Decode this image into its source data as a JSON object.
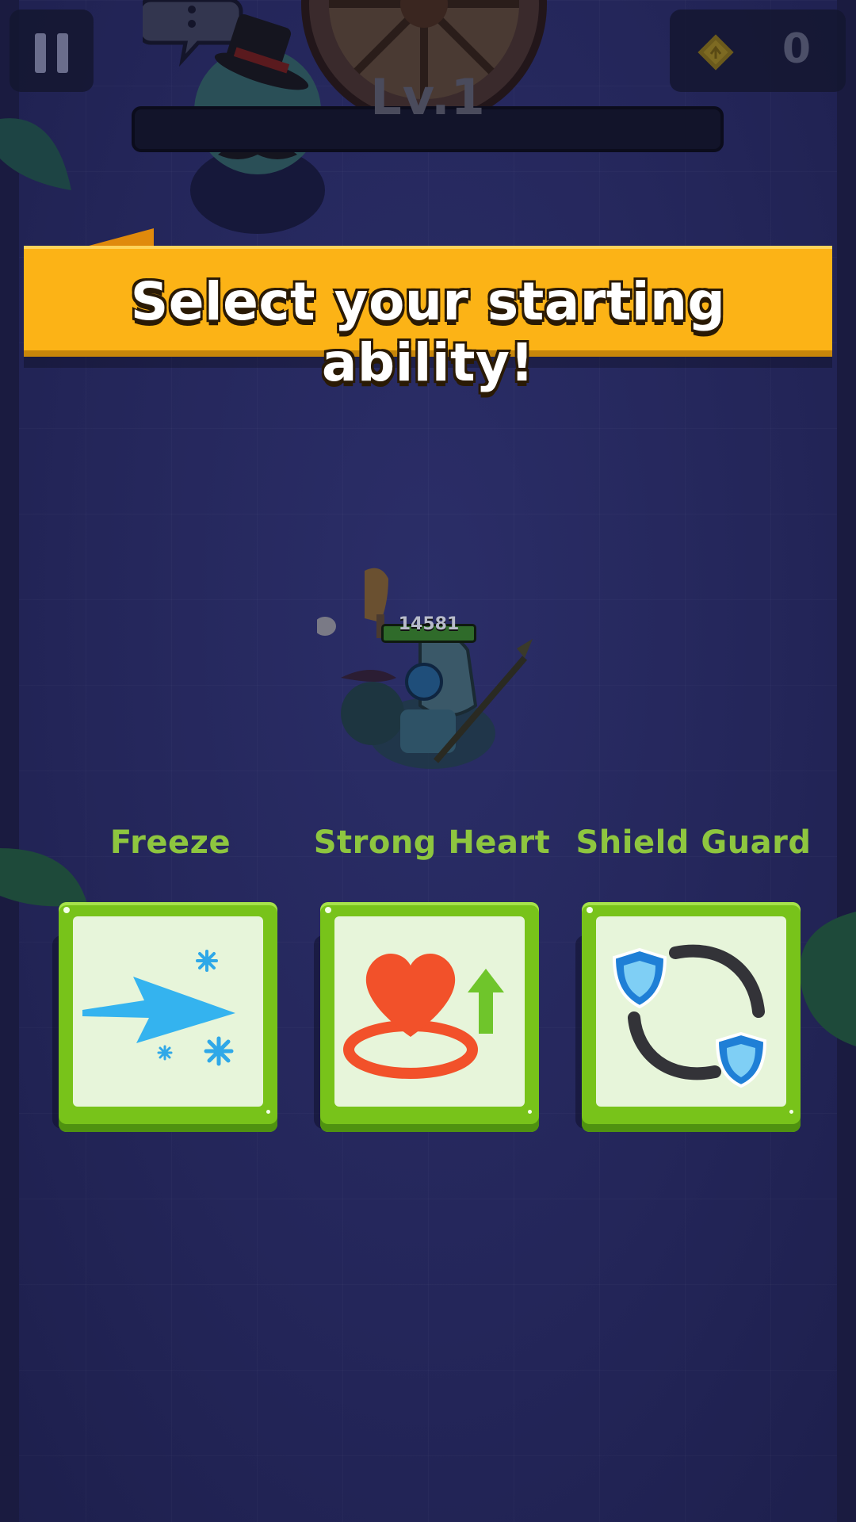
{
  "hud": {
    "gold_count": "0",
    "level": "Lv.1"
  },
  "banner": {
    "title": "Select your starting ability!"
  },
  "player": {
    "hp": "14581"
  },
  "abilities": [
    {
      "label": "Freeze",
      "icon": "freeze-arrow-icon"
    },
    {
      "label": "Strong Heart",
      "icon": "heart-up-icon"
    },
    {
      "label": "Shield Guard",
      "icon": "shield-guard-icon"
    }
  ],
  "colors": {
    "background": "#24265a",
    "banner": "#fcb316",
    "card_green": "#78c31a",
    "label_green": "#8ec63f"
  }
}
